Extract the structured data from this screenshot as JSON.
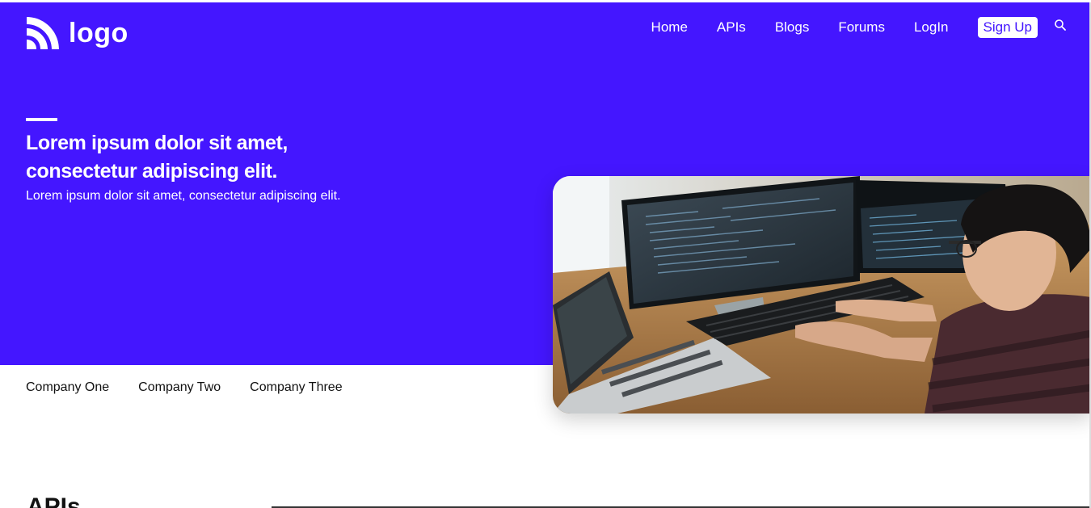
{
  "brand": {
    "logo_text": "logo",
    "logo_icon": "rss-feed-icon",
    "accent_color": "#4416ff"
  },
  "nav": {
    "items": [
      {
        "label": "Home"
      },
      {
        "label": "APIs"
      },
      {
        "label": "Blogs"
      },
      {
        "label": "Forums"
      },
      {
        "label": "LogIn"
      }
    ],
    "signup_label": "Sign Up",
    "search_icon": "search-icon"
  },
  "hero": {
    "headline_line1": "Lorem ipsum dolor sit amet,",
    "headline_line2": "consectetur adipiscing elit.",
    "subtext": "Lorem ipsum dolor sit amet, consectetur adipiscing elit."
  },
  "companies": [
    {
      "name": "Company One"
    },
    {
      "name": "Company Two"
    },
    {
      "name": "Company Three"
    }
  ],
  "section": {
    "title": "APIs"
  }
}
